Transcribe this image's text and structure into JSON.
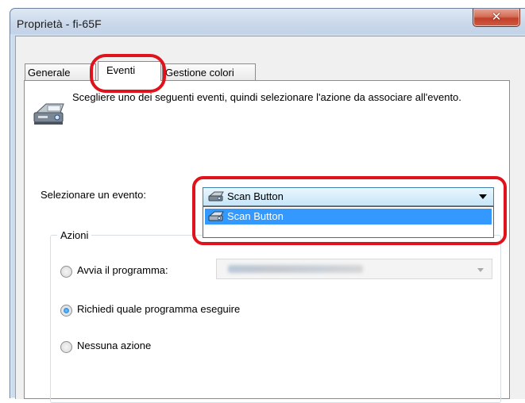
{
  "window": {
    "title": "Proprietà - fi-65F"
  },
  "tabs": [
    {
      "label": "Generale"
    },
    {
      "label": "Eventi"
    },
    {
      "label": "Gestione colori"
    }
  ],
  "events_panel": {
    "description": "Scegliere uno dei seguenti eventi, quindi selezionare l'azione da associare all'evento.",
    "select_label": "Selezionare un evento:",
    "selected_event": "Scan Button",
    "dropdown_options": [
      "Scan Button"
    ],
    "actions_title": "Azioni",
    "options": [
      {
        "label": "Avvia il programma:",
        "checked": false
      },
      {
        "label": "Richiedi quale programma eseguire",
        "checked": true
      },
      {
        "label": "Nessuna azione",
        "checked": false
      }
    ]
  },
  "colors": {
    "highlight": "#e0121c",
    "selection": "#3399ff",
    "close_button": "#c9462f"
  },
  "icons": [
    "close-icon",
    "scanner-icon",
    "scan-button-icon",
    "chevron-down-icon"
  ]
}
